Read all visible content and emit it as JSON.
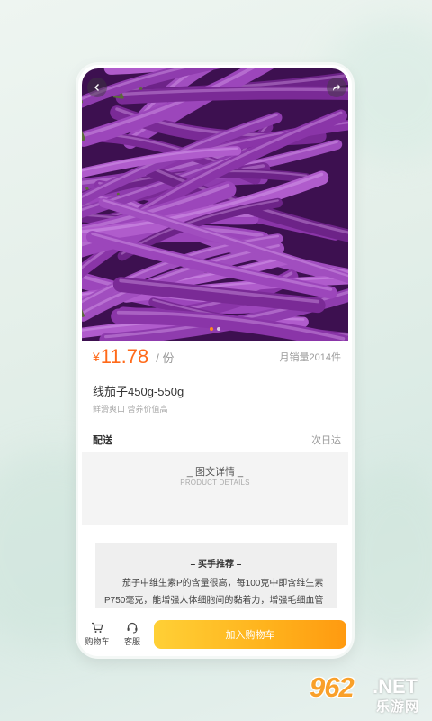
{
  "product": {
    "currency": "¥",
    "price": "11.78",
    "unit": "/ 份",
    "monthly_sales": "月销量2014件",
    "name": "线茄子450g-550g",
    "description": "鲜滑爽口 营养价值高",
    "image_icon": "eggplant-photo"
  },
  "shipping": {
    "label": "配送",
    "value": "次日达"
  },
  "details": {
    "title": "_ 图文详情 _",
    "subtitle": "PRODUCT DETAILS"
  },
  "recommend": {
    "title": "– 买手推荐 –",
    "text": "茄子中维生素P的含量很高，每100克中即含维生素P750毫克，能增强人体细胞间的黏着力，增强毛细血管的弹性。"
  },
  "tabbar": {
    "cart_label": "购物车",
    "service_label": "客服",
    "add_to_cart": "加入购物车"
  },
  "icons": {
    "back": "chevron-left-icon",
    "share": "share-icon",
    "cart": "cart-icon",
    "service": "headset-icon"
  },
  "watermark": {
    "brand_num": "962",
    "brand_net": ".NET",
    "brand_cn": "乐游网"
  },
  "colors": {
    "accent": "#ff6a1a",
    "button_start": "#ffd036",
    "button_end": "#ff9a10"
  }
}
